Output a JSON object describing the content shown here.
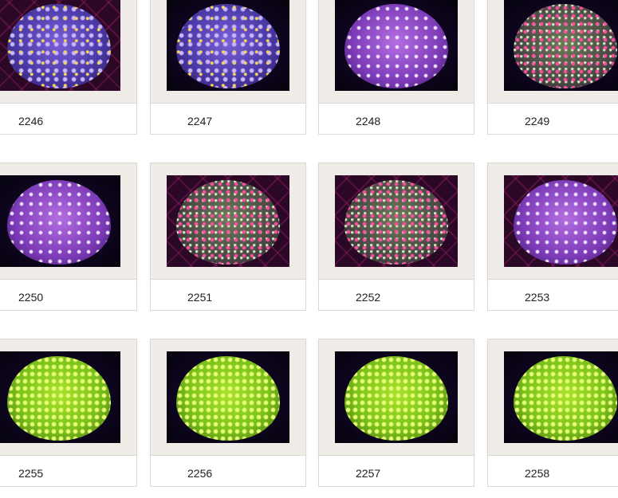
{
  "gallery": {
    "rows": [
      [
        {
          "label": "2246",
          "coral": "coral-purple",
          "bg": "bg-mesh"
        },
        {
          "label": "2247",
          "coral": "coral-purple",
          "bg": "bg-dark"
        },
        {
          "label": "2248",
          "coral": "coral-violet",
          "bg": "bg-dark"
        },
        {
          "label": "2249",
          "coral": "coral-pinkgreen",
          "bg": "bg-dark"
        }
      ],
      [
        {
          "label": "2250",
          "coral": "coral-violet",
          "bg": "bg-dark"
        },
        {
          "label": "2251",
          "coral": "coral-pinkgreen",
          "bg": "bg-mesh"
        },
        {
          "label": "2252",
          "coral": "coral-pinkgreen",
          "bg": "bg-mesh"
        },
        {
          "label": "2253",
          "coral": "coral-violet",
          "bg": "bg-mesh"
        }
      ],
      [
        {
          "label": "2255",
          "coral": "coral-green",
          "bg": "bg-dark"
        },
        {
          "label": "2256",
          "coral": "coral-green",
          "bg": "bg-dark"
        },
        {
          "label": "2257",
          "coral": "coral-green",
          "bg": "bg-dark"
        },
        {
          "label": "2258",
          "coral": "coral-green",
          "bg": "bg-dark"
        }
      ]
    ]
  }
}
